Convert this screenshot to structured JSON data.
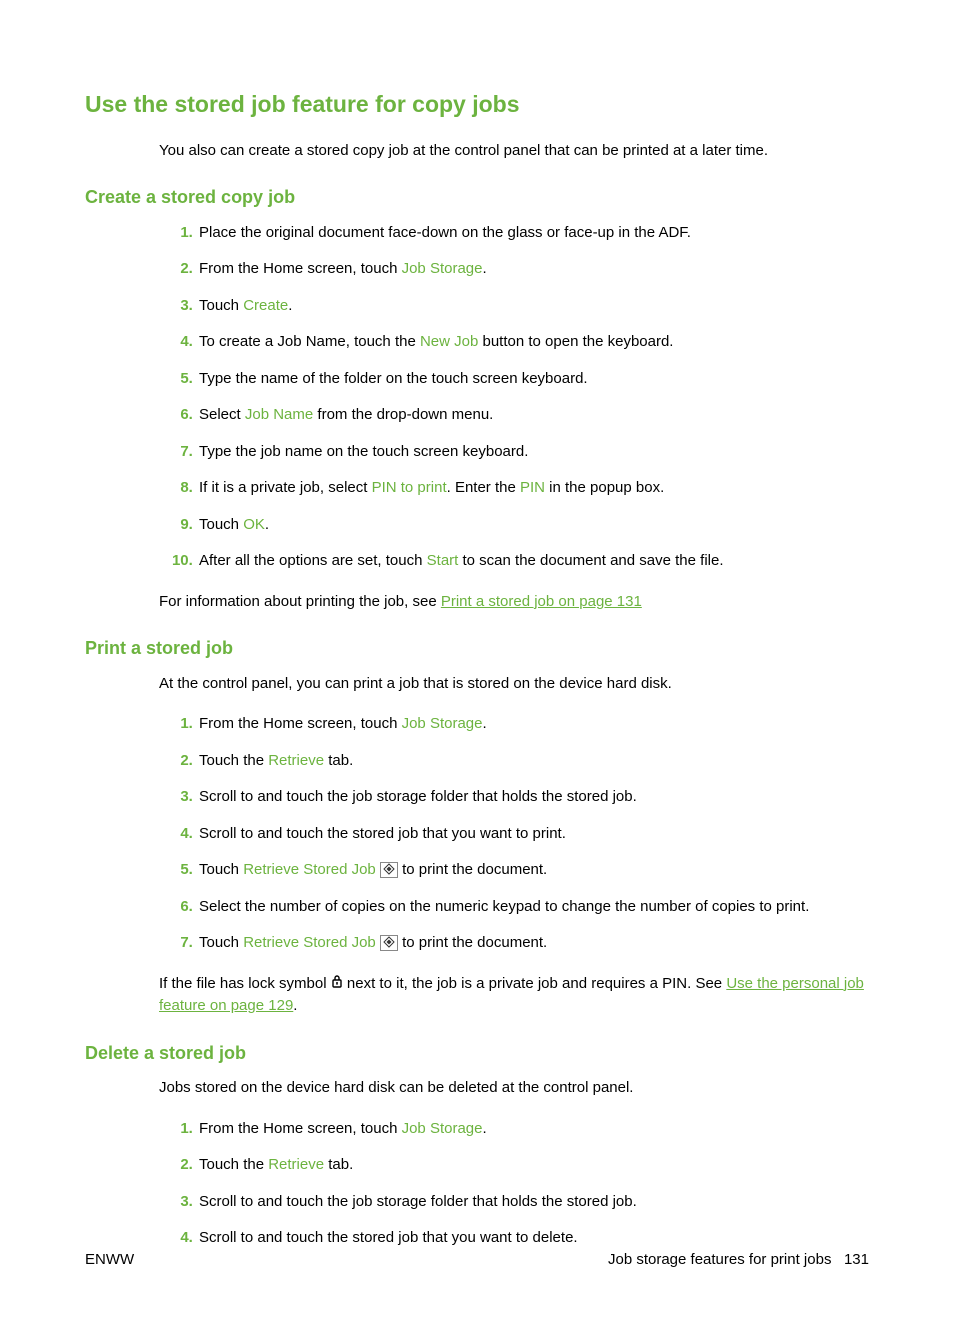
{
  "page": {
    "h1": "Use the stored job feature for copy jobs",
    "intro": "You also can create a stored copy job at the control panel that can be printed at a later time."
  },
  "create": {
    "heading": "Create a stored copy job",
    "step1": "Place the original document face-down on the glass or face-up in the ADF.",
    "step2_a": "From the Home screen, touch ",
    "step2_ui": "Job Storage",
    "step2_b": ".",
    "step3_a": "Touch ",
    "step3_ui": "Create",
    "step3_b": ".",
    "step4_a": "To create a Job Name, touch the ",
    "step4_ui": "New Job",
    "step4_b": " button to open the keyboard.",
    "step5": "Type the name of the folder on the touch screen keyboard.",
    "step6_a": "Select ",
    "step6_ui": "Job Name",
    "step6_b": " from the drop-down menu.",
    "step7": "Type the job name on the touch screen keyboard.",
    "step8_a": "If it is a private job, select ",
    "step8_ui1": "PIN to print",
    "step8_b": ". Enter the ",
    "step8_ui2": "PIN",
    "step8_c": " in the popup box.",
    "step9_a": "Touch ",
    "step9_ui": "OK",
    "step9_b": ".",
    "step10_a": "After all the options are set, touch ",
    "step10_ui": "Start",
    "step10_b": " to scan the document and save the file.",
    "post_a": "For information about printing the job, see ",
    "post_link": "Print a stored job on page 131"
  },
  "print": {
    "heading": "Print a stored job",
    "intro": "At the control panel, you can print a job that is stored on the device hard disk.",
    "step1_a": "From the Home screen, touch ",
    "step1_ui": "Job Storage",
    "step1_b": ".",
    "step2_a": "Touch the ",
    "step2_ui": "Retrieve",
    "step2_b": " tab.",
    "step3": "Scroll to and touch the job storage folder that holds the stored job.",
    "step4": "Scroll to and touch the stored job that you want to print.",
    "step5_a": "Touch ",
    "step5_ui": "Retrieve Stored Job",
    "step5_b": " to print the document.",
    "step6": "Select the number of copies on the numeric keypad to change the number of copies to print.",
    "step7_a": "Touch ",
    "step7_ui": "Retrieve Stored Job",
    "step7_b": " to print the document.",
    "post_a": "If the file has lock symbol ",
    "post_b": " next to it, the job is a private job and requires a PIN. See ",
    "post_link": "Use the personal job feature on page 129",
    "post_c": "."
  },
  "delete": {
    "heading": "Delete a stored job",
    "intro": "Jobs stored on the device hard disk can be deleted at the control panel.",
    "step1_a": "From the Home screen, touch ",
    "step1_ui": "Job Storage",
    "step1_b": ".",
    "step2_a": "Touch the ",
    "step2_ui": "Retrieve",
    "step2_b": " tab.",
    "step3": "Scroll to and touch the job storage folder that holds the stored job.",
    "step4": "Scroll to and touch the stored job that you want to delete."
  },
  "footer": {
    "left": "ENWW",
    "right_text": "Job storage features for print jobs",
    "right_page": "131"
  }
}
